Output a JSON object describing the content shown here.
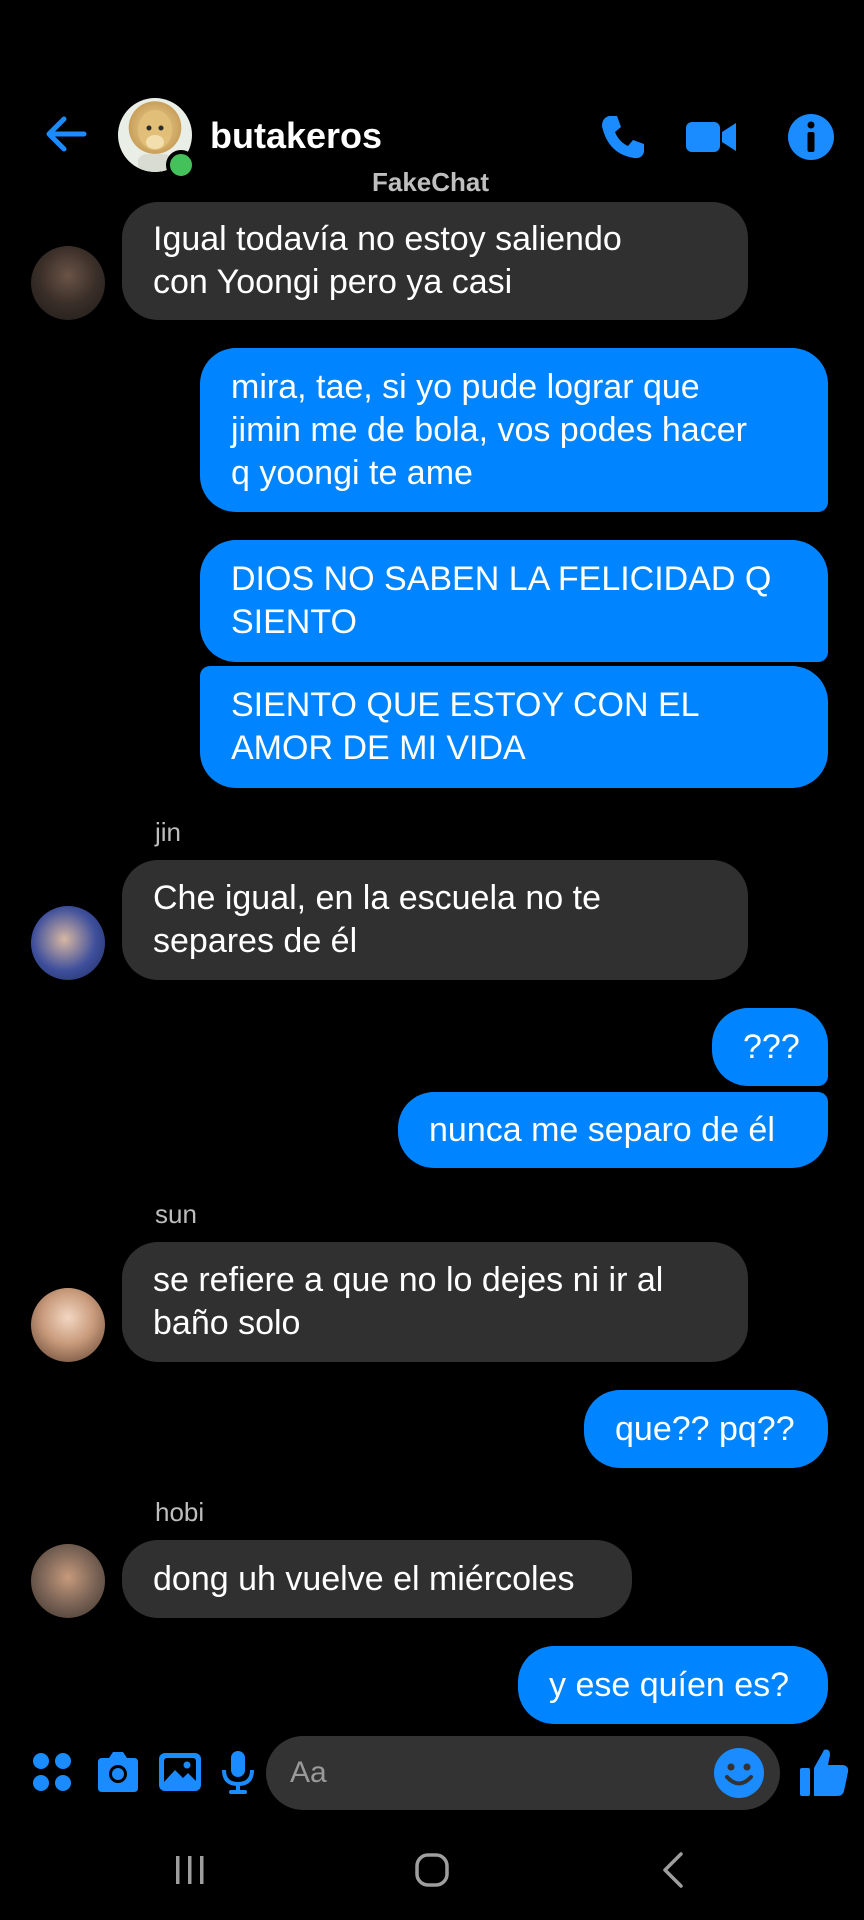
{
  "header": {
    "title": "butakeros",
    "watermark": "FakeChat"
  },
  "colors": {
    "accent": "#0084ff",
    "incoming_bubble": "#303030",
    "online": "#44c15a",
    "background": "#000000"
  },
  "messages": [
    {
      "direction": "incoming",
      "text": "Igual todavía no estoy saliendo\ncon Yoongi pero ya casi"
    },
    {
      "direction": "outgoing",
      "text": "mira, tae, si yo pude lograr que\njimin me de bola, vos podes hacer\nq yoongi te ame"
    },
    {
      "direction": "outgoing",
      "text": "DIOS NO SABEN LA FELICIDAD Q\nSIENTO"
    },
    {
      "direction": "outgoing",
      "text": "SIENTO QUE ESTOY CON EL\nAMOR DE MI VIDA"
    },
    {
      "direction": "incoming",
      "sender": "jin",
      "text": "Che igual, en la escuela no te\nsepares de él"
    },
    {
      "direction": "outgoing",
      "text": "???"
    },
    {
      "direction": "outgoing",
      "text": "nunca me separo de él"
    },
    {
      "direction": "incoming",
      "sender": "sun",
      "text": "se refiere a que no lo dejes ni ir al\nbaño solo"
    },
    {
      "direction": "outgoing",
      "text": "que?? pq??"
    },
    {
      "direction": "incoming",
      "sender": "hobi",
      "text": "dong uh vuelve el miércoles"
    },
    {
      "direction": "outgoing",
      "text": "y ese quíen es?"
    }
  ],
  "composer": {
    "placeholder": "Aa"
  },
  "icons": {
    "header": [
      "back-arrow-icon",
      "phone-icon",
      "video-camera-icon",
      "info-icon"
    ],
    "composer": [
      "apps-icon",
      "camera-icon",
      "gallery-icon",
      "microphone-icon",
      "emoji-icon",
      "thumbs-up-icon"
    ],
    "navigation": [
      "recents-icon",
      "home-icon",
      "back-icon"
    ]
  }
}
